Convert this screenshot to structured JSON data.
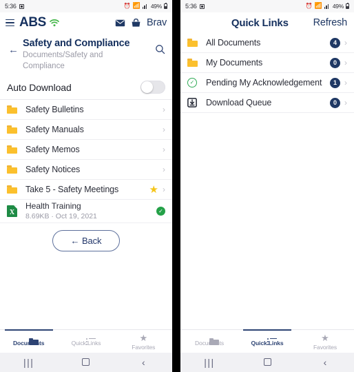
{
  "status_bar": {
    "time": "5:36",
    "battery": "49%",
    "icons": [
      "screenshot-icon",
      "alarm-icon",
      "wifi-off-icon",
      "signal-icon",
      "battery-icon"
    ]
  },
  "left_panel": {
    "appbar": {
      "menu": "menu-icon",
      "brand": "ABS",
      "wifi": "wifi-icon",
      "mail": "mail-icon",
      "bag": "bag-icon",
      "user": "Brav"
    },
    "header": {
      "back": "←",
      "title": "Safety and Compliance",
      "subtitle": "Documents/Safety and Compliance",
      "search": "search-icon"
    },
    "auto_download": {
      "label": "Auto Download",
      "enabled": false
    },
    "items": [
      {
        "label": "Safety Bulletins",
        "icon": "folder-icon",
        "starred": false,
        "chevron": "›"
      },
      {
        "label": "Safety Manuals",
        "icon": "folder-icon",
        "starred": false,
        "chevron": "›"
      },
      {
        "label": "Safety Memos",
        "icon": "folder-icon",
        "starred": false,
        "chevron": "›"
      },
      {
        "label": "Safety Notices",
        "icon": "folder-icon",
        "starred": false,
        "chevron": "›"
      },
      {
        "label": "Take 5 - Safety Meetings",
        "icon": "folder-icon",
        "starred": true,
        "chevron": "›"
      }
    ],
    "file": {
      "name": "Health Training",
      "meta": "8.69KB  ·  Oct 19, 2021",
      "icon": "excel-file-icon",
      "status": "downloaded-check"
    },
    "back_button": "←  Back"
  },
  "right_panel": {
    "header": {
      "title": "Quick Links",
      "refresh": "Refresh"
    },
    "items": [
      {
        "label": "All Documents",
        "icon": "folder-icon",
        "count": "4",
        "chevron": "›"
      },
      {
        "label": "My Documents",
        "icon": "folder-icon",
        "count": "0",
        "chevron": "›"
      },
      {
        "label": "Pending My Acknowledgement",
        "icon": "check-circle-icon",
        "count": "1",
        "chevron": "›"
      },
      {
        "label": "Download Queue",
        "icon": "download-icon",
        "count": "0",
        "chevron": "›"
      }
    ]
  },
  "tabbar": {
    "tabs": [
      {
        "label": "Documents",
        "icon": "folder-icon"
      },
      {
        "label": "Quick Links",
        "icon": "list-icon"
      },
      {
        "label": "Favorites",
        "icon": "star-icon"
      }
    ],
    "left_active_index": 0,
    "right_active_index": 1
  },
  "sysnav": {
    "recent": "|||",
    "home": "home-square-icon",
    "back": "‹"
  },
  "colors": {
    "brand_navy": "#15305e",
    "folder_yellow": "#fbc02d",
    "star_yellow": "#f5c518",
    "badge_navy": "#1f3864",
    "green_check": "#24a148",
    "excel_green": "#1e8b45"
  }
}
